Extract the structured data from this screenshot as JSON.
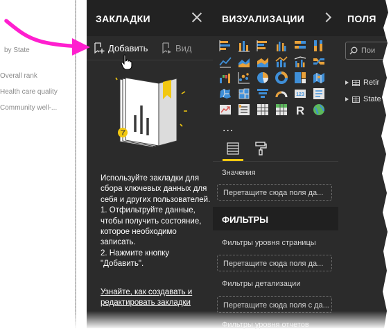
{
  "canvas": {
    "visual_title": "by State",
    "legend_items": [
      "Overall rank",
      "Health care quality",
      "Community well-..."
    ]
  },
  "bookmarks": {
    "title": "ЗАКЛАДКИ",
    "add_label": "Добавить",
    "view_label": "Вид",
    "instructions": "Используйте закладки для сбора ключевых данных для себя и других пользователей.\n1. Отфильтруйте данные, чтобы получить состояние, которое необходимо записать.\n2. Нажмите кнопку \"Добавить\".",
    "link": "Узнайте, как создавать и редактировать закладки"
  },
  "visualizations": {
    "title": "ВИЗУАЛИЗАЦИИ",
    "more": "...",
    "values_label": "Значения",
    "values_well": "Перетащите сюда поля да...",
    "filters_title": "ФИЛЬТРЫ",
    "page_filters_label": "Фильтры уровня страницы",
    "page_filters_well": "Перетащите сюда поля да...",
    "drill_filters_label": "Фильтры детализации",
    "drill_filters_well": "Перетащите сюда поля с да...",
    "report_filters_label": "Фильтры уровня отчетов"
  },
  "fields": {
    "title": "ПОЛЯ",
    "search_placeholder": "Пои",
    "items": [
      "Retir",
      "State"
    ]
  },
  "colors": {
    "pane_bg": "#2b2b2b",
    "header_bg": "#222222",
    "accent_yellow": "#f2c811",
    "annotation_arrow": "#ff1fcf",
    "viz_orange": "#e8a13a",
    "viz_blue": "#3f8fd8"
  }
}
